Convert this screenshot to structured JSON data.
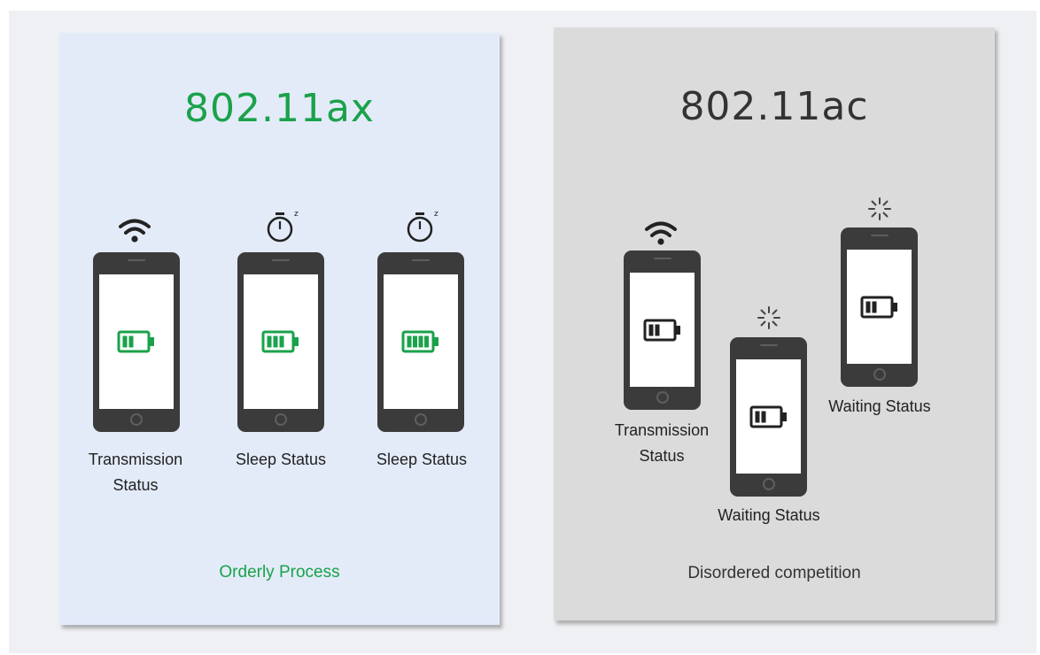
{
  "colors": {
    "accent_green": "#1aa24a",
    "dark_text": "#333333",
    "phone_body": "#3b3b3b"
  },
  "panel_ax": {
    "title": "802.11ax",
    "caption": "Orderly Process",
    "devices": [
      {
        "label_line1": "Transmission",
        "label_line2": "Status",
        "status_icon": "wifi-icon",
        "battery_bars": 2
      },
      {
        "label_line1": "Sleep Status",
        "label_line2": "",
        "status_icon": "stopwatch-sleep-icon",
        "battery_bars": 3
      },
      {
        "label_line1": "Sleep Status",
        "label_line2": "",
        "status_icon": "stopwatch-sleep-icon",
        "battery_bars": 4
      }
    ]
  },
  "panel_ac": {
    "title": "802.11ac",
    "caption": "Disordered competition",
    "devices": [
      {
        "label_line1": "Transmission",
        "label_line2": "Status",
        "status_icon": "wifi-icon",
        "battery_bars": 2
      },
      {
        "label_line1": "Waiting Status",
        "label_line2": "",
        "status_icon": "loading-spinner-icon",
        "battery_bars": 2
      },
      {
        "label_line1": "Waiting Status",
        "label_line2": "",
        "status_icon": "loading-spinner-icon",
        "battery_bars": 2
      }
    ]
  }
}
